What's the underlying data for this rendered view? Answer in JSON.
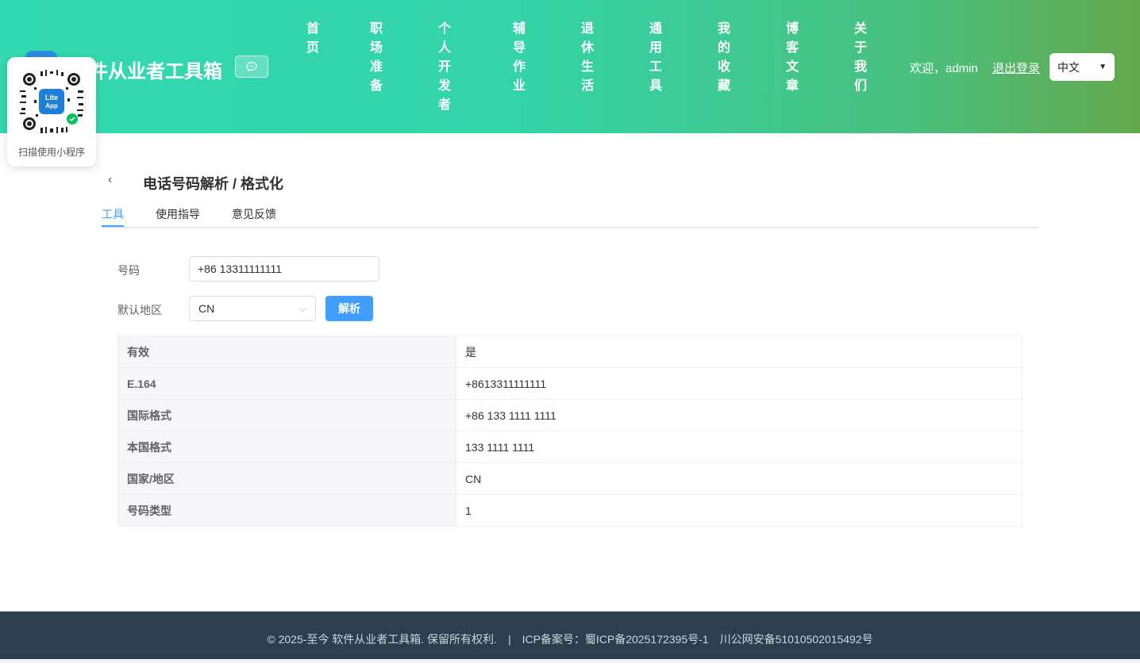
{
  "header": {
    "site_title": "件从业者工具箱",
    "nav": [
      "首页",
      "职场准备",
      "个人开发者",
      "辅导作业",
      "退休生活",
      "通用工具",
      "我的收藏",
      "博客文章",
      "关于我们"
    ],
    "welcome": "欢迎，admin",
    "logout": "退出登录",
    "language": "中文"
  },
  "qr": {
    "caption": "扫描使用小程序",
    "badge_top": "Lite",
    "badge_bottom": "App"
  },
  "page": {
    "title": "电话号码解析 / 格式化",
    "tabs": [
      "工具",
      "使用指导",
      "意见反馈"
    ]
  },
  "form": {
    "number_label": "号码",
    "number_value": "+86 13311111111",
    "region_label": "默认地区",
    "region_value": "CN",
    "parse_button": "解析"
  },
  "results": [
    {
      "key": "有效",
      "value": "是"
    },
    {
      "key": "E.164",
      "value": "+8613311111111"
    },
    {
      "key": "国际格式",
      "value": "+86 133 1111 1111"
    },
    {
      "key": "本国格式",
      "value": "133 1111 1111"
    },
    {
      "key": "国家/地区",
      "value": "CN"
    },
    {
      "key": "号码类型",
      "value": "1"
    }
  ],
  "footer": {
    "copyright": "© 2025-至今 软件从业者工具箱. 保留所有权利.",
    "separator": "|",
    "icp": "ICP备案号：蜀ICP备2025172395号-1",
    "police": "川公网安备51010502015492号"
  },
  "colors": {
    "accent": "#409eff",
    "header_start": "#33d9b0",
    "header_end": "#63a84c",
    "footer_bg": "#2c3e50"
  }
}
